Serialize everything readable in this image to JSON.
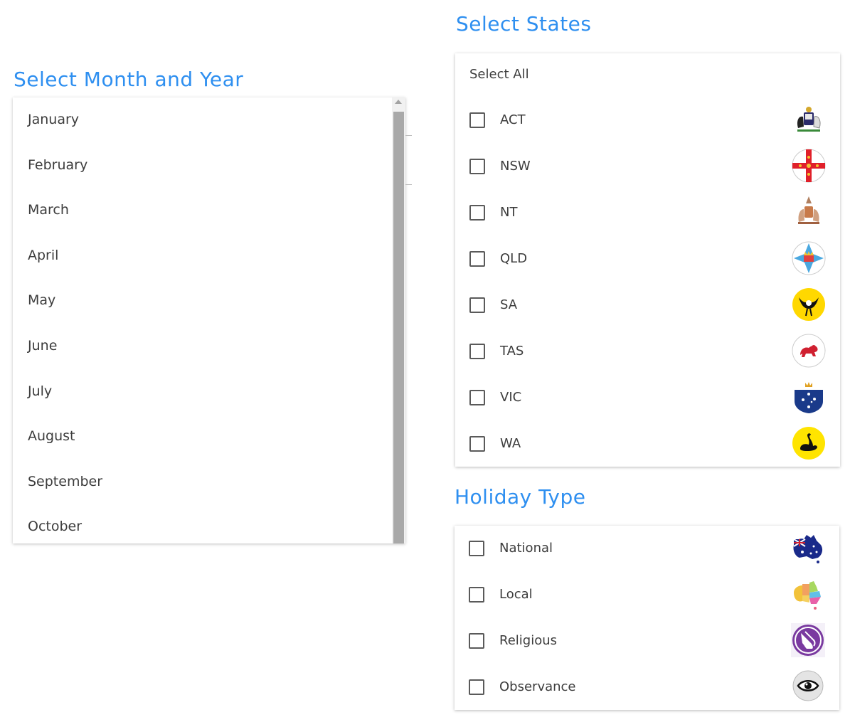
{
  "month_section": {
    "heading": "Select Month and Year",
    "months": [
      "January",
      "February",
      "March",
      "April",
      "May",
      "June",
      "July",
      "August",
      "September",
      "October"
    ]
  },
  "states_section": {
    "heading": "Select States",
    "select_all_label": "Select All",
    "states": [
      {
        "label": "ACT",
        "icon": "act-coat-of-arms-icon"
      },
      {
        "label": "NSW",
        "icon": "nsw-flag-badge-icon"
      },
      {
        "label": "NT",
        "icon": "nt-coat-of-arms-icon"
      },
      {
        "label": "QLD",
        "icon": "qld-badge-icon"
      },
      {
        "label": "SA",
        "icon": "sa-piping-shrike-icon"
      },
      {
        "label": "TAS",
        "icon": "tas-red-lion-icon"
      },
      {
        "label": "VIC",
        "icon": "vic-southern-cross-badge-icon"
      },
      {
        "label": "WA",
        "icon": "wa-black-swan-icon"
      }
    ]
  },
  "holiday_section": {
    "heading": "Holiday Type",
    "types": [
      {
        "label": "National",
        "icon": "australia-flag-map-icon"
      },
      {
        "label": "Local",
        "icon": "australia-states-map-icon"
      },
      {
        "label": "Religious",
        "icon": "praying-hands-icon"
      },
      {
        "label": "Observance",
        "icon": "eye-icon"
      }
    ]
  },
  "colors": {
    "heading": "#2e8ff0",
    "text": "#3c3c3c",
    "checkbox_border": "#5a5a5a",
    "scroll_thumb": "#a9a9a9"
  }
}
